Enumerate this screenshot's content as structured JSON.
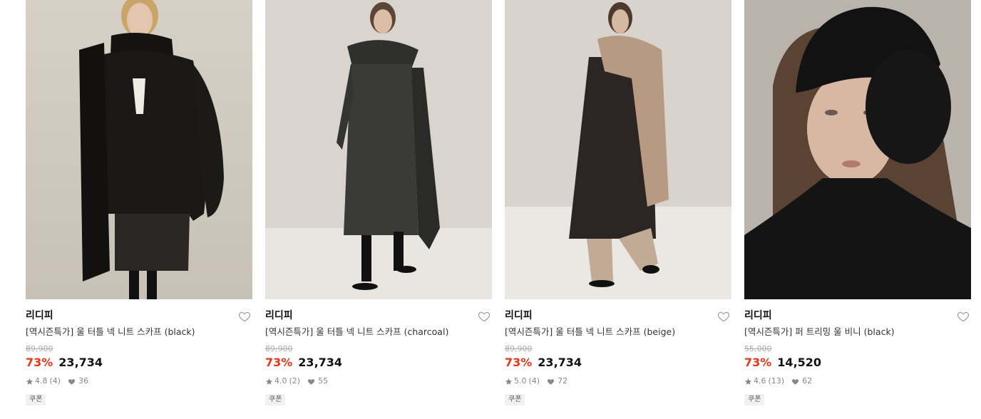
{
  "products": [
    {
      "brand": "리디피",
      "name": "[역시즌특가] 울 터틀 넥 니트 스카프 (black)",
      "original_price": "89,900",
      "discount": "73%",
      "price": "23,734",
      "rating": "4.8",
      "reviews": "(4)",
      "likes": "36",
      "coupon": "쿠폰",
      "image": "model-black-cardigan-scarf"
    },
    {
      "brand": "리디피",
      "name": "[역시즌특가] 울 터틀 넥 니트 스카프 (charcoal)",
      "original_price": "89,900",
      "discount": "73%",
      "price": "23,734",
      "rating": "4.0",
      "reviews": "(2)",
      "likes": "55",
      "coupon": "쿠폰",
      "image": "model-charcoal-coat-scarf"
    },
    {
      "brand": "리디피",
      "name": "[역시즌특가] 울 터틀 넥 니트 스카프 (beige)",
      "original_price": "89,900",
      "discount": "73%",
      "price": "23,734",
      "rating": "5.0",
      "reviews": "(4)",
      "likes": "72",
      "coupon": "쿠폰",
      "image": "model-beige-scarf-coat"
    },
    {
      "brand": "리디피",
      "name": "[역시즌특가] 퍼 트리밍 울 비니 (black)",
      "original_price": "55,000",
      "discount": "73%",
      "price": "14,520",
      "rating": "4.6",
      "reviews": "(13)",
      "likes": "62",
      "coupon": "쿠폰",
      "image": "model-black-fur-beanie"
    }
  ],
  "colors": {
    "discount": "#e8341a",
    "strike": "#aaaaaa",
    "meta": "#888888"
  },
  "icons": {
    "like": "heart-outline-icon",
    "star": "star-icon",
    "likes": "heart-filled-icon"
  }
}
